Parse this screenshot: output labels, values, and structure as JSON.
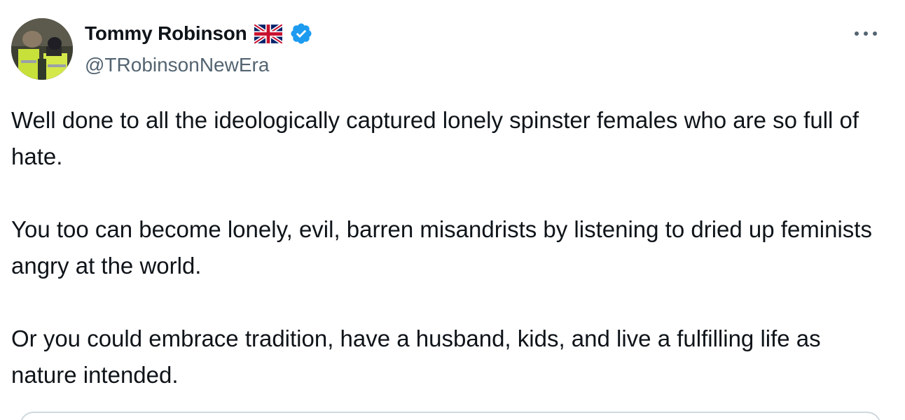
{
  "author": {
    "display_name": "Tommy Robinson",
    "handle": "@TRobinsonNewEra",
    "flag_icon": "uk-flag-icon",
    "verified_icon": "verified-badge-icon",
    "verified_color": "#1d9bf0"
  },
  "tweet": {
    "paragraphs": [
      "Well done to all the ideologically captured lonely spinster females who are so full of hate.",
      "You too can become lonely, evil, barren misandrists by listening to dried up feminists angry at the world.",
      "Or you could embrace tradition, have a husband, kids, and live a fulfilling life as nature intended."
    ]
  },
  "menu": {
    "more_icon": "more-options-icon"
  },
  "colors": {
    "text_primary": "#0f1419",
    "text_secondary": "#536471",
    "border": "#cfd9de"
  }
}
